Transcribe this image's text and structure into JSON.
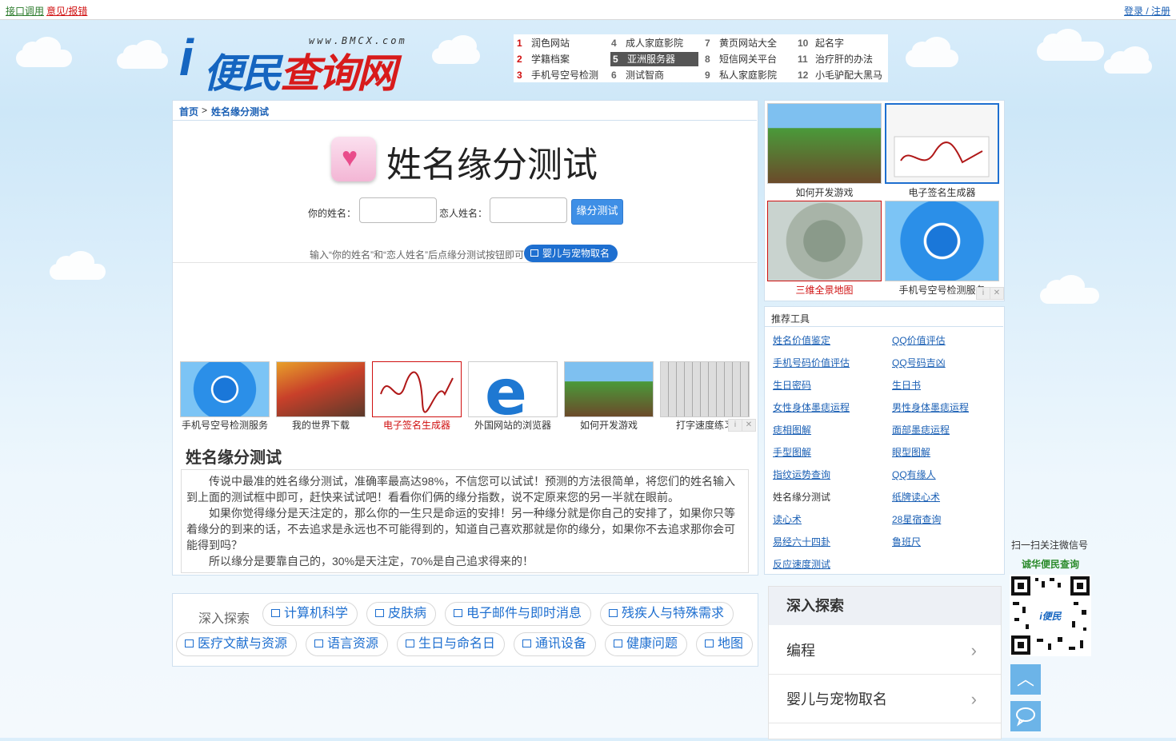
{
  "topbar": {
    "api": "接口调用",
    "feedback": "意见/报错",
    "login": "登录 / 注册"
  },
  "logo": {
    "url": "www.BMCX.com",
    "title_a": "便民",
    "title_b": "查询网",
    "mark": "i"
  },
  "ranking": [
    {
      "n": "1",
      "label": "润色网站"
    },
    {
      "n": "2",
      "label": "学籍档案"
    },
    {
      "n": "3",
      "label": "手机号空号检测"
    },
    {
      "n": "4",
      "label": "成人家庭影院"
    },
    {
      "n": "5",
      "label": "亚洲服务器"
    },
    {
      "n": "6",
      "label": "测试智商"
    },
    {
      "n": "7",
      "label": "黄页网站大全"
    },
    {
      "n": "8",
      "label": "短信网关平台"
    },
    {
      "n": "9",
      "label": "私人家庭影院"
    },
    {
      "n": "10",
      "label": "起名字"
    },
    {
      "n": "11",
      "label": "治疗肝的办法"
    },
    {
      "n": "12",
      "label": "小毛驴配大黑马"
    }
  ],
  "breadcrumb": {
    "home": "首页",
    "sep": " > ",
    "current": "姓名缘分测试"
  },
  "tool": {
    "title": "姓名缘分测试",
    "your_name_label": "你的姓名：",
    "lover_name_label": "恋人姓名：",
    "your_name_value": "",
    "lover_name_value": "",
    "button": "缘分测试",
    "hint": "输入“你的姓名”和“恋人姓名”后点缘分测试按钮即可",
    "hint_pill": "婴儿与宠物取名"
  },
  "thumbs": [
    {
      "label": "手机号空号检测服务",
      "red": false
    },
    {
      "label": "我的世界下载",
      "red": false
    },
    {
      "label": "电子签名生成器",
      "red": true
    },
    {
      "label": "外国网站的浏览器",
      "red": false
    },
    {
      "label": "如何开发游戏",
      "red": false
    },
    {
      "label": "打字速度练习",
      "red": false
    }
  ],
  "article": {
    "heading": "姓名缘分测试",
    "paragraphs": [
      "传说中最准的姓名缘分测试，准确率最高达98%，不信您可以试试！预测的方法很简单，将您们的姓名输入到上面的测试框中即可，赶快来试试吧！看看你们俩的缘分指数，说不定原来您的另一半就在眼前。",
      "如果你觉得缘分是天注定的，那么你的一生只是命运的安排！另一种缘分就是你自己的安排了，如果你只等着缘分的到来的话，不去追求是永远也不可能得到的，知道自己喜欢那就是你的缘分，如果你不去追求那你会可能得到吗？",
      "所以缘分是要靠自己的，30%是天注定，70%是自己追求得来的！"
    ]
  },
  "explore": {
    "label": "深入探索",
    "chips": [
      "计算机科学",
      "皮肤病",
      "电子邮件与即时消息",
      "残疾人与特殊需求",
      "医疗文献与资源",
      "语言资源",
      "生日与命名日",
      "通讯设备",
      "健康问题",
      "地图"
    ]
  },
  "side_thumbs": [
    {
      "label": "如何开发游戏",
      "red": false
    },
    {
      "label": "电子签名生成器",
      "red": false
    },
    {
      "label": "三维全景地图",
      "red": true
    },
    {
      "label": "手机号空号检测服务",
      "red": false
    }
  ],
  "recommend": {
    "title": "推荐工具",
    "left": [
      "姓名价值鉴定",
      "手机号码价值评估",
      "生日密码",
      "女性身体墨痣运程",
      "痣相图解",
      "手型图解",
      "指纹运势查询",
      "姓名缘分测试",
      "读心术",
      "易经六十四卦",
      "反应速度测试"
    ],
    "right": [
      "QQ价值评估",
      "QQ号码吉凶",
      "生日书",
      "男性身体墨痣运程",
      "面部墨痣运程",
      "眼型图解",
      "QQ有缘人",
      "纸牌读心术",
      "28星宿查询",
      "鲁班尺"
    ]
  },
  "explore_card": {
    "title": "深入探索",
    "rows": [
      "编程",
      "婴儿与宠物取名"
    ]
  },
  "wechat": {
    "line1": "扫一扫关注微信号",
    "line2": "诚华便民查询"
  },
  "colors": {
    "brand_blue": "#1565c0",
    "brand_red": "#d81b1b",
    "accent": "#3e8fe6"
  }
}
